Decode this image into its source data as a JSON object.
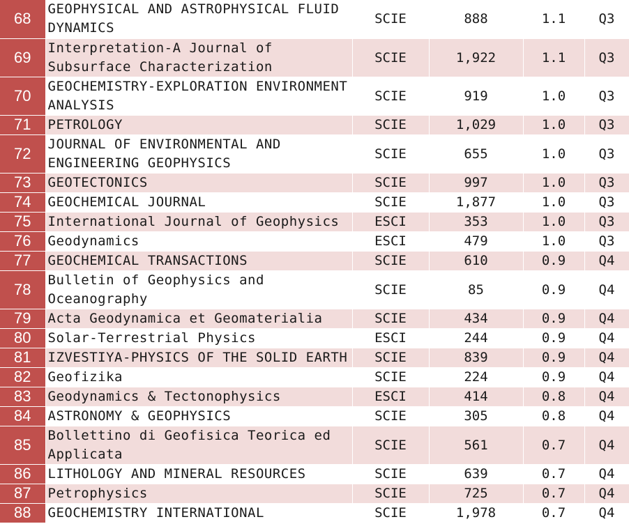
{
  "colors": {
    "rank_bg": "#c0504d",
    "band_pink": "#f2dcdb",
    "band_white": "#ffffff"
  },
  "rows": [
    {
      "rank": "68",
      "line1": "GEOPHYSICAL AND ASTROPHYSICAL FLUID",
      "line2": "DYNAMICS",
      "index": "SCIE",
      "count": "888",
      "if": "1.1",
      "quartile": "Q3"
    },
    {
      "rank": "69",
      "line1": "Interpretation-A Journal of",
      "line2": "Subsurface Characterization",
      "index": "SCIE",
      "count": "1,922",
      "if": "1.1",
      "quartile": "Q3"
    },
    {
      "rank": "70",
      "line1": "GEOCHEMISTRY-EXPLORATION ENVIRONMENT",
      "line2": "ANALYSIS",
      "index": "SCIE",
      "count": "919",
      "if": "1.0",
      "quartile": "Q3"
    },
    {
      "rank": "71",
      "line1": "PETROLOGY",
      "index": "SCIE",
      "count": "1,029",
      "if": "1.0",
      "quartile": "Q3"
    },
    {
      "rank": "72",
      "line1": "JOURNAL OF ENVIRONMENTAL AND",
      "line2": "ENGINEERING GEOPHYSICS",
      "index": "SCIE",
      "count": "655",
      "if": "1.0",
      "quartile": "Q3"
    },
    {
      "rank": "73",
      "line1": "GEOTECTONICS",
      "index": "SCIE",
      "count": "997",
      "if": "1.0",
      "quartile": "Q3"
    },
    {
      "rank": "74",
      "line1": "GEOCHEMICAL JOURNAL",
      "index": "SCIE",
      "count": "1,877",
      "if": "1.0",
      "quartile": "Q3"
    },
    {
      "rank": "75",
      "line1": "International Journal of Geophysics",
      "index": "ESCI",
      "count": "353",
      "if": "1.0",
      "quartile": "Q3"
    },
    {
      "rank": "76",
      "line1": "Geodynamics",
      "index": "ESCI",
      "count": "479",
      "if": "1.0",
      "quartile": "Q3"
    },
    {
      "rank": "77",
      "line1": "GEOCHEMICAL TRANSACTIONS",
      "index": "SCIE",
      "count": "610",
      "if": "0.9",
      "quartile": "Q4"
    },
    {
      "rank": "78",
      "line1": "Bulletin of Geophysics and",
      "line2": "Oceanography",
      "index": "SCIE",
      "count": "85",
      "if": "0.9",
      "quartile": "Q4"
    },
    {
      "rank": "79",
      "line1": "Acta Geodynamica et Geomaterialia",
      "index": "SCIE",
      "count": "434",
      "if": "0.9",
      "quartile": "Q4"
    },
    {
      "rank": "80",
      "line1": "Solar-Terrestrial Physics",
      "index": "ESCI",
      "count": "244",
      "if": "0.9",
      "quartile": "Q4"
    },
    {
      "rank": "81",
      "line1": "IZVESTIYA-PHYSICS OF THE SOLID EARTH",
      "index": "SCIE",
      "count": "839",
      "if": "0.9",
      "quartile": "Q4"
    },
    {
      "rank": "82",
      "line1": "Geofizika",
      "index": "SCIE",
      "count": "224",
      "if": "0.9",
      "quartile": "Q4"
    },
    {
      "rank": "83",
      "line1": "Geodynamics & Tectonophysics",
      "index": "ESCI",
      "count": "414",
      "if": "0.8",
      "quartile": "Q4"
    },
    {
      "rank": "84",
      "line1": "ASTRONOMY & GEOPHYSICS",
      "index": "SCIE",
      "count": "305",
      "if": "0.8",
      "quartile": "Q4"
    },
    {
      "rank": "85",
      "line1": "Bollettino di Geofisica Teorica ed",
      "line2": "Applicata",
      "index": "SCIE",
      "count": "561",
      "if": "0.7",
      "quartile": "Q4"
    },
    {
      "rank": "86",
      "line1": "LITHOLOGY AND MINERAL RESOURCES",
      "index": "SCIE",
      "count": "639",
      "if": "0.7",
      "quartile": "Q4"
    },
    {
      "rank": "87",
      "line1": "Petrophysics",
      "index": "SCIE",
      "count": "725",
      "if": "0.7",
      "quartile": "Q4"
    },
    {
      "rank": "88",
      "line1": "GEOCHEMISTRY INTERNATIONAL",
      "index": "SCIE",
      "count": "1,978",
      "if": "0.7",
      "quartile": "Q4"
    }
  ]
}
